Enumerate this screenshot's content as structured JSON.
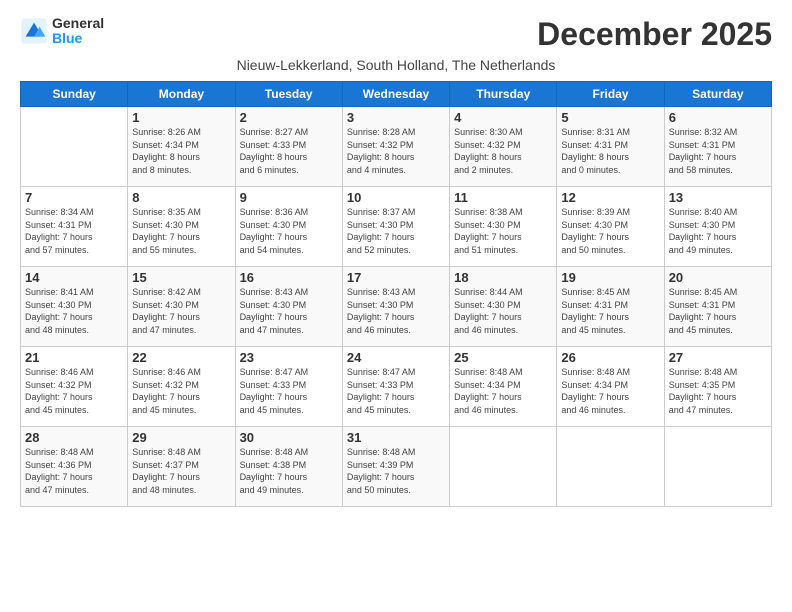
{
  "logo": {
    "general": "General",
    "blue": "Blue"
  },
  "title": "December 2025",
  "subtitle": "Nieuw-Lekkerland, South Holland, The Netherlands",
  "headers": [
    "Sunday",
    "Monday",
    "Tuesday",
    "Wednesday",
    "Thursday",
    "Friday",
    "Saturday"
  ],
  "weeks": [
    [
      {
        "day": "",
        "info": ""
      },
      {
        "day": "1",
        "info": "Sunrise: 8:26 AM\nSunset: 4:34 PM\nDaylight: 8 hours\nand 8 minutes."
      },
      {
        "day": "2",
        "info": "Sunrise: 8:27 AM\nSunset: 4:33 PM\nDaylight: 8 hours\nand 6 minutes."
      },
      {
        "day": "3",
        "info": "Sunrise: 8:28 AM\nSunset: 4:32 PM\nDaylight: 8 hours\nand 4 minutes."
      },
      {
        "day": "4",
        "info": "Sunrise: 8:30 AM\nSunset: 4:32 PM\nDaylight: 8 hours\nand 2 minutes."
      },
      {
        "day": "5",
        "info": "Sunrise: 8:31 AM\nSunset: 4:31 PM\nDaylight: 8 hours\nand 0 minutes."
      },
      {
        "day": "6",
        "info": "Sunrise: 8:32 AM\nSunset: 4:31 PM\nDaylight: 7 hours\nand 58 minutes."
      }
    ],
    [
      {
        "day": "7",
        "info": "Sunrise: 8:34 AM\nSunset: 4:31 PM\nDaylight: 7 hours\nand 57 minutes."
      },
      {
        "day": "8",
        "info": "Sunrise: 8:35 AM\nSunset: 4:30 PM\nDaylight: 7 hours\nand 55 minutes."
      },
      {
        "day": "9",
        "info": "Sunrise: 8:36 AM\nSunset: 4:30 PM\nDaylight: 7 hours\nand 54 minutes."
      },
      {
        "day": "10",
        "info": "Sunrise: 8:37 AM\nSunset: 4:30 PM\nDaylight: 7 hours\nand 52 minutes."
      },
      {
        "day": "11",
        "info": "Sunrise: 8:38 AM\nSunset: 4:30 PM\nDaylight: 7 hours\nand 51 minutes."
      },
      {
        "day": "12",
        "info": "Sunrise: 8:39 AM\nSunset: 4:30 PM\nDaylight: 7 hours\nand 50 minutes."
      },
      {
        "day": "13",
        "info": "Sunrise: 8:40 AM\nSunset: 4:30 PM\nDaylight: 7 hours\nand 49 minutes."
      }
    ],
    [
      {
        "day": "14",
        "info": "Sunrise: 8:41 AM\nSunset: 4:30 PM\nDaylight: 7 hours\nand 48 minutes."
      },
      {
        "day": "15",
        "info": "Sunrise: 8:42 AM\nSunset: 4:30 PM\nDaylight: 7 hours\nand 47 minutes."
      },
      {
        "day": "16",
        "info": "Sunrise: 8:43 AM\nSunset: 4:30 PM\nDaylight: 7 hours\nand 47 minutes."
      },
      {
        "day": "17",
        "info": "Sunrise: 8:43 AM\nSunset: 4:30 PM\nDaylight: 7 hours\nand 46 minutes."
      },
      {
        "day": "18",
        "info": "Sunrise: 8:44 AM\nSunset: 4:30 PM\nDaylight: 7 hours\nand 46 minutes."
      },
      {
        "day": "19",
        "info": "Sunrise: 8:45 AM\nSunset: 4:31 PM\nDaylight: 7 hours\nand 45 minutes."
      },
      {
        "day": "20",
        "info": "Sunrise: 8:45 AM\nSunset: 4:31 PM\nDaylight: 7 hours\nand 45 minutes."
      }
    ],
    [
      {
        "day": "21",
        "info": "Sunrise: 8:46 AM\nSunset: 4:32 PM\nDaylight: 7 hours\nand 45 minutes."
      },
      {
        "day": "22",
        "info": "Sunrise: 8:46 AM\nSunset: 4:32 PM\nDaylight: 7 hours\nand 45 minutes."
      },
      {
        "day": "23",
        "info": "Sunrise: 8:47 AM\nSunset: 4:33 PM\nDaylight: 7 hours\nand 45 minutes."
      },
      {
        "day": "24",
        "info": "Sunrise: 8:47 AM\nSunset: 4:33 PM\nDaylight: 7 hours\nand 45 minutes."
      },
      {
        "day": "25",
        "info": "Sunrise: 8:48 AM\nSunset: 4:34 PM\nDaylight: 7 hours\nand 46 minutes."
      },
      {
        "day": "26",
        "info": "Sunrise: 8:48 AM\nSunset: 4:34 PM\nDaylight: 7 hours\nand 46 minutes."
      },
      {
        "day": "27",
        "info": "Sunrise: 8:48 AM\nSunset: 4:35 PM\nDaylight: 7 hours\nand 47 minutes."
      }
    ],
    [
      {
        "day": "28",
        "info": "Sunrise: 8:48 AM\nSunset: 4:36 PM\nDaylight: 7 hours\nand 47 minutes."
      },
      {
        "day": "29",
        "info": "Sunrise: 8:48 AM\nSunset: 4:37 PM\nDaylight: 7 hours\nand 48 minutes."
      },
      {
        "day": "30",
        "info": "Sunrise: 8:48 AM\nSunset: 4:38 PM\nDaylight: 7 hours\nand 49 minutes."
      },
      {
        "day": "31",
        "info": "Sunrise: 8:48 AM\nSunset: 4:39 PM\nDaylight: 7 hours\nand 50 minutes."
      },
      {
        "day": "",
        "info": ""
      },
      {
        "day": "",
        "info": ""
      },
      {
        "day": "",
        "info": ""
      }
    ]
  ]
}
